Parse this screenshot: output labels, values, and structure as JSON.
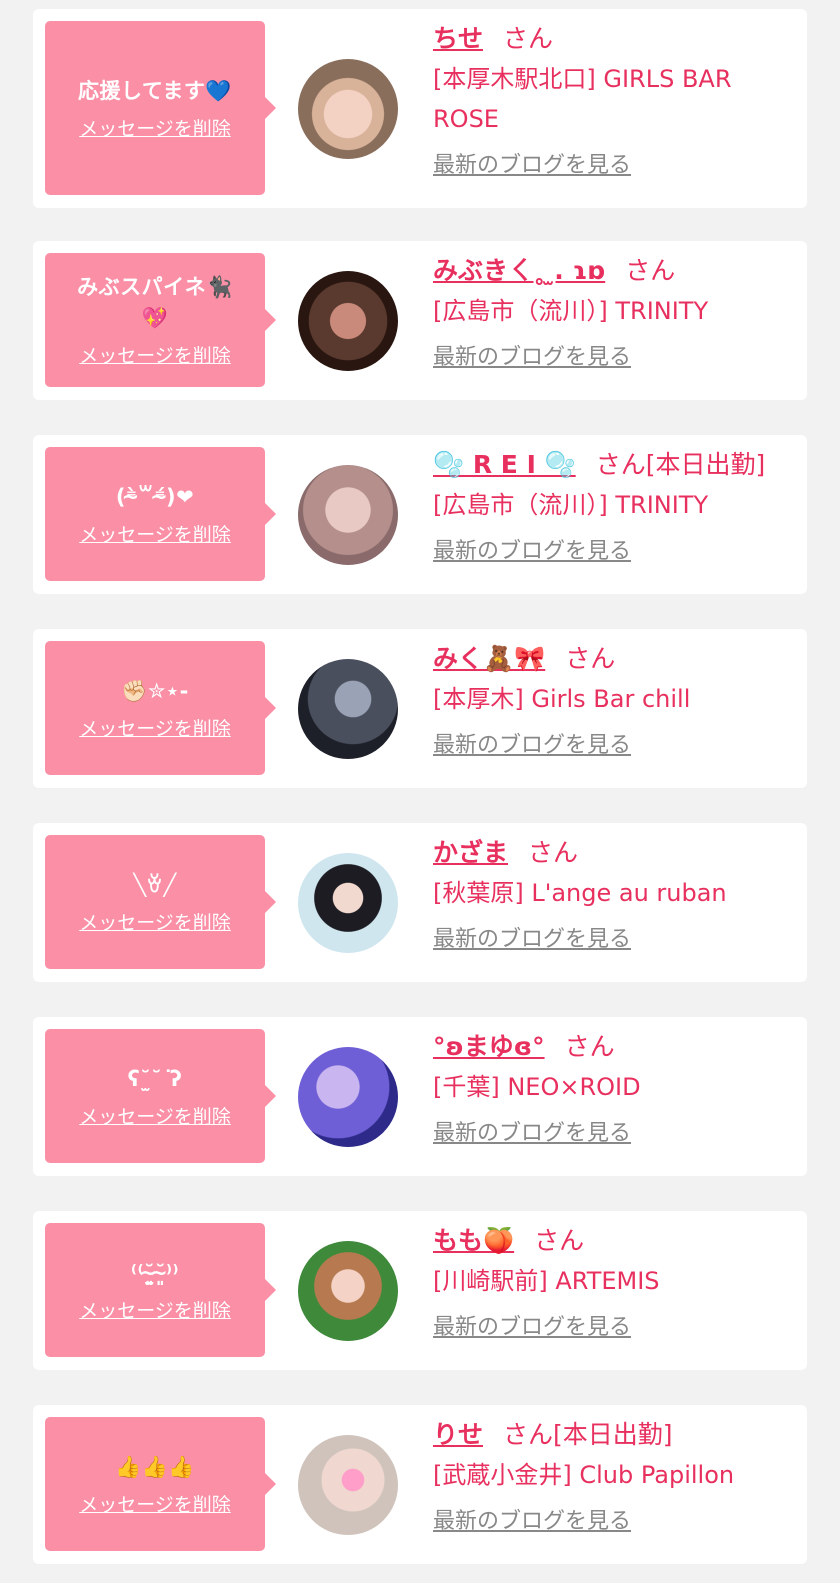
{
  "delete_label": "メッセージを削除",
  "blog_label": "最新のブログを見る",
  "colors": {
    "bubble": "#fa8fa6",
    "accent": "#e8305f",
    "link_gray": "#888888",
    "background": "#f2f2f2"
  },
  "items": [
    {
      "message": "応援してます💙",
      "name": "ちせ",
      "honorific": "さん",
      "shop": "[本厚木駅北口] GIRLS BAR ROSE",
      "avatar_icon": "girl-photo"
    },
    {
      "message": "みぶスパイネ🐈‍⬛\n💖",
      "name": "みぶきㄑ˳ ̫. ɿɒ",
      "honorific": "さん",
      "shop": "[広島市（流川）] TRINITY",
      "avatar_icon": "girl-photo"
    },
    {
      "message": "(⁼̴̀꒳⁼̴́)❤",
      "name": "🫧 R E I 🫧",
      "honorific": "さん[本日出勤]",
      "shop": "[広島市（流川）] TRINITY",
      "avatar_icon": "girl-photo"
    },
    {
      "message": "✊🏻✮⋆-",
      "name": "みく🧸🎀",
      "honorific": "さん",
      "shop": "[本厚木] Girls Bar chill",
      "avatar_icon": "girl-photo"
    },
    {
      "message": "╲ꈊ╱",
      "name": "かざま",
      "honorific": "さん",
      "shop": "[秋葉原] L'ange au ruban",
      "avatar_icon": "girl-photo"
    },
    {
      "message": "ʕ˘̫˘ ͘ʔ",
      "name": "°ʚまゆɞ°",
      "honorific": "さん",
      "shop": "[千葉] NEO×ROID",
      "avatar_icon": "girl-photo"
    },
    {
      "message": "⁽⁽˘̴͈̫˘̴͈⁾⁾",
      "name": "もも🍑",
      "honorific": "さん",
      "shop": "[川崎駅前] ARTEMIS",
      "avatar_icon": "girl-photo"
    },
    {
      "message": "👍👍👍",
      "name": "りせ",
      "honorific": "さん[本日出勤]",
      "shop": "[武蔵小金井] Club Papillon",
      "avatar_icon": "girl-photo"
    }
  ]
}
